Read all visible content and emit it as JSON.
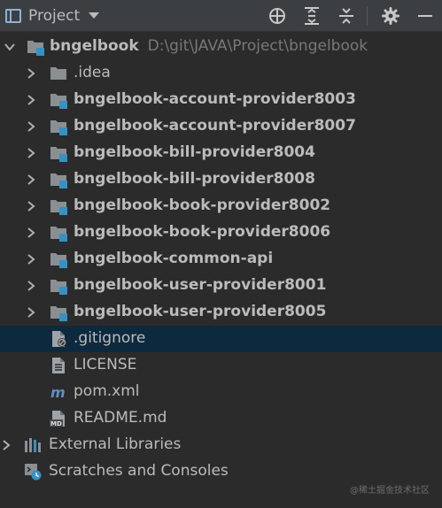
{
  "header": {
    "title": "Project"
  },
  "tree": {
    "root": {
      "label": "bngelbook",
      "path": "D:\\git\\JAVA\\Project\\bngelbook"
    },
    "folders": [
      {
        "label": ".idea"
      },
      {
        "label": "bngelbook-account-provider8003"
      },
      {
        "label": "bngelbook-account-provider8007"
      },
      {
        "label": "bngelbook-bill-provider8004"
      },
      {
        "label": "bngelbook-bill-provider8008"
      },
      {
        "label": "bngelbook-book-provider8002"
      },
      {
        "label": "bngelbook-book-provider8006"
      },
      {
        "label": "bngelbook-common-api"
      },
      {
        "label": "bngelbook-user-provider8001"
      },
      {
        "label": "bngelbook-user-provider8005"
      }
    ],
    "files": [
      {
        "label": ".gitignore"
      },
      {
        "label": "LICENSE"
      },
      {
        "label": "pom.xml"
      },
      {
        "label": "README.md"
      }
    ],
    "external": {
      "label": "External Libraries"
    },
    "scratches": {
      "label": "Scratches and Consoles"
    }
  },
  "watermark": "@稀土掘金技术社区",
  "colors": {
    "background": "#2b2b2b",
    "header": "#3c3f41",
    "selected_row": "#0d293e",
    "text": "#bbbbbb",
    "module_badge": "#3592c4"
  }
}
